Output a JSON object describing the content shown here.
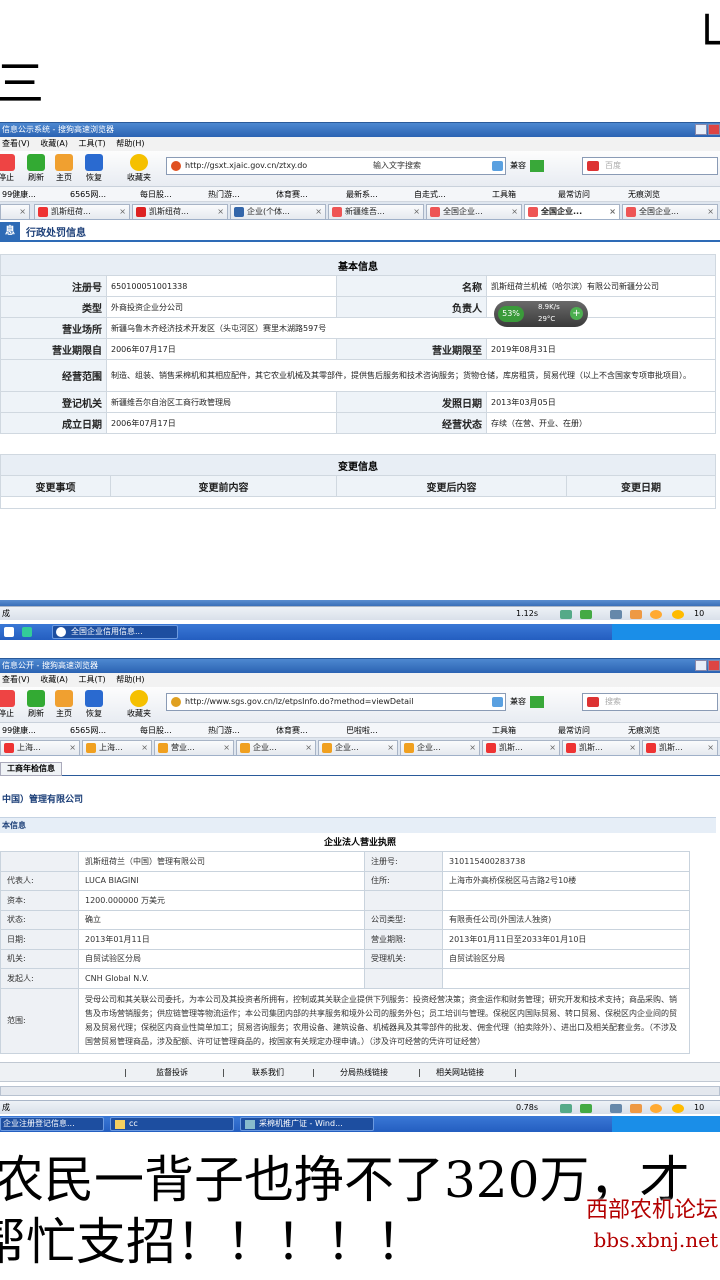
{
  "top_overlay": {
    "left_char": "三",
    "right_char": "山"
  },
  "bottom_caption": {
    "line1": "农民一背子也挣不了320万，",
    "line1_tail": "才",
    "line2": "帮忙支招！！！！！"
  },
  "watermark": {
    "line1": "西部农机论坛",
    "line2": "bbs.xbnj.net"
  },
  "win1": {
    "title": "信息公示系统 - 搜狗高速浏览器",
    "menu": [
      "查看(V)",
      "收藏(A)",
      "工具(T)",
      "帮助(H)"
    ],
    "buttons": [
      "停止",
      "刷新",
      "主页",
      "恢复",
      "收藏夹"
    ],
    "url": "http://gsxt.xjaic.gov.cn/ztxy.do",
    "url_hint": "输入文字搜索",
    "compat": "兼容",
    "search_placeholder": "百度",
    "favorites": [
      "99健康...",
      "6565网...",
      "每日股...",
      "热门游...",
      "体育赛...",
      "最新系...",
      "自走式...",
      "工具箱",
      "最常访问",
      "无痕浏览"
    ],
    "tabs": [
      "凯斯纽荷...",
      "凯斯纽荷...",
      "企业(个体...",
      "新疆维吾...",
      "全国企业...",
      "全国企业...",
      "全国企业..."
    ],
    "subtabs": [
      "息",
      "行政处罚信息"
    ],
    "basic_title": "基本信息",
    "fields": {
      "reg_no_label": "注册号",
      "reg_no": "650100051001338",
      "name_label": "名称",
      "name": "凯斯纽荷兰机械（哈尔滨）有限公司新疆分公司",
      "type_label": "类型",
      "type": "外商投资企业分公司",
      "owner_label": "负责人",
      "place_label": "营业场所",
      "place": "新疆乌鲁木齐经济技术开发区（头屯河区）赛里木湖路597号",
      "from_label": "营业期限自",
      "from": "2006年07月17日",
      "to_label": "营业期限至",
      "to": "2019年08月31日",
      "scope_label": "经营范围",
      "scope": "制造、组装、销售采棉机和其相应配件，其它农业机械及其零部件，提供售后服务和技术咨询服务；货物仓储，库房租赁，贸易代理（以上不含国家专项审批项目）。",
      "authority_label": "登记机关",
      "authority": "新疆维吾尔自治区工商行政管理局",
      "issue_label": "发照日期",
      "issue": "2013年03月05日",
      "est_label": "成立日期",
      "est": "2006年07月17日",
      "status_label": "经营状态",
      "status": "存续（在营、开业、在册）"
    },
    "widget": {
      "percent": "53%",
      "speed": "8.9K/s",
      "temp": "29°C"
    },
    "change_title": "变更信息",
    "change_cols": [
      "变更事项",
      "变更前内容",
      "变更后内容",
      "变更日期"
    ],
    "status_left": "成",
    "status_time": "1.12s",
    "zoom": "10",
    "taskbar_item": "全国企业信用信息..."
  },
  "win2": {
    "title": "信息公开 - 搜狗高速浏览器",
    "menu": [
      "查看(V)",
      "收藏(A)",
      "工具(T)",
      "帮助(H)"
    ],
    "buttons": [
      "停止",
      "刷新",
      "主页",
      "恢复",
      "收藏夹"
    ],
    "url": "http://www.sgs.gov.cn/lz/etpsInfo.do?method=viewDetail",
    "compat": "兼容",
    "search_placeholder": "搜索",
    "favorites": [
      "99健康...",
      "6565网...",
      "每日股...",
      "热门游...",
      "体育赛...",
      "巴啦啦...",
      "工具箱",
      "最常访问",
      "无痕浏览"
    ],
    "tabs": [
      "上海...",
      "上海...",
      "营业...",
      "企业...",
      "企业...",
      "企业...",
      "企业...",
      "凯斯...",
      "凯斯...",
      "凯斯..."
    ],
    "subtab": "工商年检信息",
    "company_title": "中国）管理有限公司",
    "section": "本信息",
    "license_title": "企业法人营业执照",
    "rows": [
      {
        "l1": "",
        "v1": "凯斯纽荷兰（中国）管理有限公司",
        "l2": "注册号:",
        "v2": "310115400283738"
      },
      {
        "l1": "代表人:",
        "v1": "LUCA BIAGINI",
        "l2": "住所:",
        "v2": "上海市外高桥保税区马吉路2号10楼"
      },
      {
        "l1": "资本:",
        "v1": "1200.000000  万美元",
        "l2": "",
        "v2": ""
      },
      {
        "l1": "状态:",
        "v1": "确立",
        "l2": "公司类型:",
        "v2": "有限责任公司(外国法人独资)"
      },
      {
        "l1": "日期:",
        "v1": "2013年01月11日",
        "l2": "营业期限:",
        "v2": "2013年01月11日至2033年01月10日"
      },
      {
        "l1": "机关:",
        "v1": "自贸试验区分局",
        "l2": "受理机关:",
        "v2": "自贸试验区分局"
      },
      {
        "l1": "发起人:",
        "v1": "CNH Global N.V.",
        "l2": "",
        "v2": ""
      }
    ],
    "scope_label": "范围:",
    "scope": "受母公司和其关联公司委托，为本公司及其投资者所拥有，控制或其关联企业提供下列服务：投资经营决策；资金运作和财务管理；研究开发和技术支持；商品采购、销售及市场营销服务；供应链管理等物流运作；本公司集团内部的共享服务和境外公司的服务外包；员工培训与管理。保税区内国际贸易、转口贸易、保税区内企业间的贸易及贸易代理；保税区内商业性简单加工；贸易咨询服务；农用设备、建筑设备、机械器具及其零部件的批发、佣金代理（拍卖除外）、进出口及相关配套业务。（不涉及国营贸易管理商品，涉及配额、许可证管理商品的，按国家有关规定办理申请。）（涉及许可经营的凭许可证经营）",
    "footer_links": [
      "监督投诉",
      "联系我们",
      "分局热线链接",
      "相关网站链接"
    ],
    "status_left": "成",
    "status_time": "0.78s",
    "zoom": "10",
    "taskbar_items": [
      "企业注册登记信息...",
      "cc",
      "采棉机推广证 - Wind..."
    ]
  },
  "colors": {
    "titlebar": "#2b63b3",
    "taskbar": "#245ec0",
    "label_bg": "#eef3f8",
    "widget": "#3a9a3a"
  }
}
